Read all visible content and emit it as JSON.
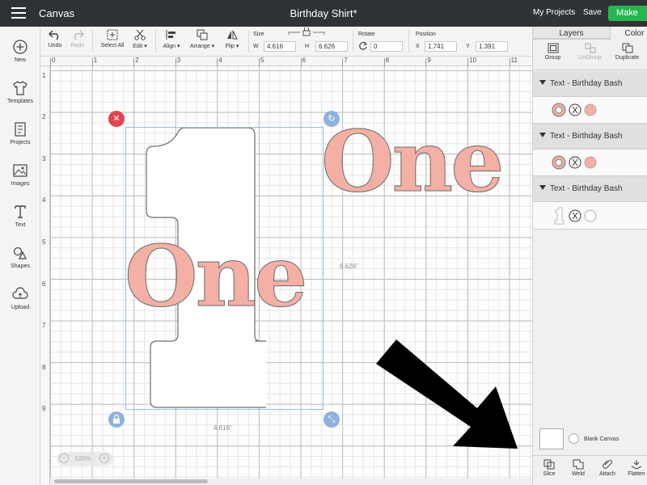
{
  "topbar": {
    "app_title": "Canvas",
    "doc_title": "Birthday Shirt*",
    "my_projects": "My Projects",
    "save": "Save",
    "make": "Make"
  },
  "toolbar": {
    "undo": "Undo",
    "redo": "Redo",
    "select_all": "Select All",
    "edit": "Edit",
    "align": "Align",
    "arrange": "Arrange",
    "flip": "Flip",
    "size_label": "Size",
    "w_label": "W",
    "w_value": "4.616",
    "h_label": "H",
    "h_value": "6.626",
    "rotate_label": "Rotate",
    "rotate_value": "0",
    "position_label": "Position",
    "x_label": "X",
    "x_value": "1.741",
    "y_label": "Y",
    "y_value": "1.391"
  },
  "leftnav": {
    "items": [
      {
        "label": "New"
      },
      {
        "label": "Templates"
      },
      {
        "label": "Projects"
      },
      {
        "label": "Images"
      },
      {
        "label": "Text"
      },
      {
        "label": "Shapes"
      },
      {
        "label": "Upload"
      }
    ]
  },
  "rulers": {
    "top": [
      "0",
      "1",
      "2",
      "3",
      "4",
      "5",
      "6",
      "7",
      "8",
      "9",
      "10",
      "11"
    ],
    "left": [
      "1",
      "2",
      "3",
      "4",
      "5",
      "6",
      "7",
      "8",
      "9"
    ]
  },
  "canvas": {
    "text_top": "One",
    "text_mid": "One",
    "height_dim": "6.626\"",
    "width_dim": "4.616\"",
    "zoom": "100%",
    "colors": {
      "accent_text": "#f4b0a4",
      "outline": "#6b6b6b",
      "selection": "#9bbfe0",
      "delete": "#e0444e"
    }
  },
  "rpanel": {
    "tabs": [
      "Layers",
      "Color"
    ],
    "actions": {
      "group": "Group",
      "ungroup": "UnGroup",
      "duplicate": "Duplicate"
    },
    "groups": [
      {
        "title": "Text - Birthday Bash"
      },
      {
        "title": "Text - Birthday Bash"
      },
      {
        "title": "Text - Birthday Bash"
      }
    ],
    "blank_canvas": "Blank Canvas",
    "bottom": {
      "slice": "Slice",
      "weld": "Weld",
      "attach": "Attach",
      "flatten": "Flatten"
    }
  }
}
